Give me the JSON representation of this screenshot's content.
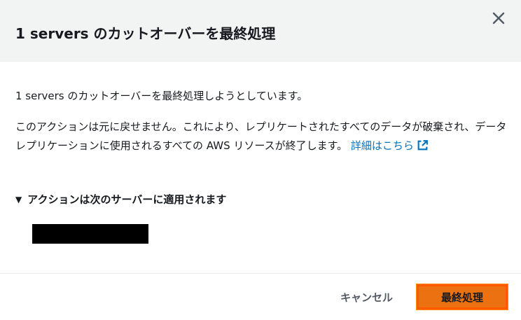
{
  "modal": {
    "title": "1 servers のカットオーバーを最終処理",
    "close_icon": "close-icon"
  },
  "body": {
    "intro": "1 servers のカットオーバーを最終処理しようとしています。",
    "warning": "このアクションは元に戻せません。これにより、レプリケートされたすべてのデータが破棄され、データレプリケーションに使用されるすべての AWS リソースが終了します。",
    "learn_more": "詳細はこちら",
    "learn_more_icon": "external-link-icon",
    "expander_label": "アクションは次のサーバーに適用されます",
    "expander_icon": "caret-down-icon"
  },
  "footer": {
    "cancel_label": "キャンセル",
    "finalize_label": "最終処理"
  },
  "colors": {
    "primary_button": "#ec7211",
    "link": "#0073bb",
    "header_bg": "#f2f3f3"
  }
}
